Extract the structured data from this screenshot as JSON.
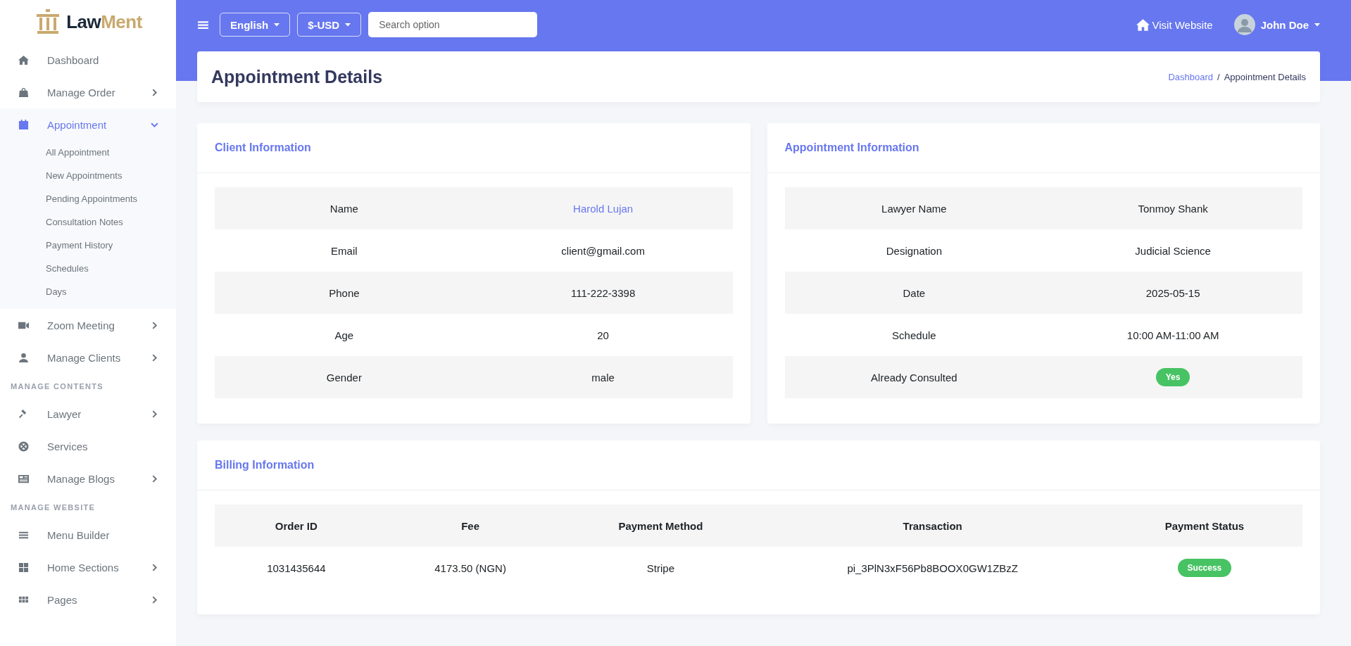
{
  "sidebar": {
    "logo": {
      "text_1": "Law",
      "text_2": "Ment"
    },
    "items": [
      {
        "kind": "link",
        "label": "Dashboard",
        "selected": false
      },
      {
        "kind": "menu",
        "label": "Manage Order",
        "selected": false,
        "expanded": false
      },
      {
        "kind": "menu",
        "label": "Appointment",
        "selected": true,
        "expanded": true,
        "children": [
          {
            "label": "All Appointment"
          },
          {
            "label": "New Appointments"
          },
          {
            "label": "Pending Appointments"
          },
          {
            "label": "Consultation Notes"
          },
          {
            "label": "Payment History"
          },
          {
            "label": "Schedules"
          },
          {
            "label": "Days"
          }
        ]
      },
      {
        "kind": "menu",
        "label": "Zoom Meeting",
        "selected": false,
        "expanded": false
      },
      {
        "kind": "menu",
        "label": "Manage Clients",
        "selected": false,
        "expanded": false
      },
      {
        "kind": "header",
        "label": "MANAGE CONTENTS"
      },
      {
        "kind": "menu",
        "label": "Lawyer",
        "selected": false,
        "expanded": false
      },
      {
        "kind": "link",
        "label": "Services",
        "selected": false
      },
      {
        "kind": "menu",
        "label": "Manage Blogs",
        "selected": false,
        "expanded": false
      },
      {
        "kind": "header",
        "label": "MANAGE WEBSITE"
      },
      {
        "kind": "link",
        "label": "Menu Builder",
        "selected": false
      },
      {
        "kind": "menu",
        "label": "Home Sections",
        "selected": false,
        "expanded": false
      },
      {
        "kind": "menu",
        "label": "Pages",
        "selected": false,
        "expanded": false
      }
    ]
  },
  "topbar": {
    "language": "English",
    "currency": "$-USD",
    "search": {
      "placeholder": "Search option"
    },
    "visit_website": "Visit Website",
    "user": "John Doe"
  },
  "page_header": {
    "title": "Appointment Details",
    "breadcrumb": [
      "Dashboard",
      "Appointment Details"
    ],
    "separator": "/"
  },
  "cards": [
    {
      "title": "Client Information",
      "rows": [
        {
          "kind": "link",
          "label": "Name",
          "value": "Harold Lujan"
        },
        {
          "kind": "text",
          "label": "Email",
          "value": "client@gmail.com"
        },
        {
          "kind": "text",
          "label": "Phone",
          "value": "111-222-3398"
        },
        {
          "kind": "text",
          "label": "Age",
          "value": "20"
        },
        {
          "kind": "text",
          "label": "Gender",
          "value": "male"
        }
      ]
    },
    {
      "title": "Appointment Information",
      "rows": [
        {
          "kind": "text",
          "label": "Lawyer Name",
          "value": "Tonmoy Shank"
        },
        {
          "kind": "text",
          "label": "Designation",
          "value": "Judicial Science"
        },
        {
          "kind": "text",
          "label": "Date",
          "value": "2025-05-15"
        },
        {
          "kind": "text",
          "label": "Schedule",
          "value": "10:00 AM-11:00 AM"
        },
        {
          "kind": "badge",
          "label": "Already Consulted",
          "value": "Yes"
        }
      ]
    }
  ],
  "billing": {
    "title": "Billing Information",
    "columns": [
      "Order ID",
      "Fee",
      "Payment Method",
      "Transaction",
      "Payment Status"
    ],
    "rows": [
      [
        "1031435644",
        "4173.50 (NGN)",
        "Stripe",
        "pi_3PlN3xF56Pb8BOOX0GW1ZBzZ",
        "Success"
      ]
    ]
  }
}
